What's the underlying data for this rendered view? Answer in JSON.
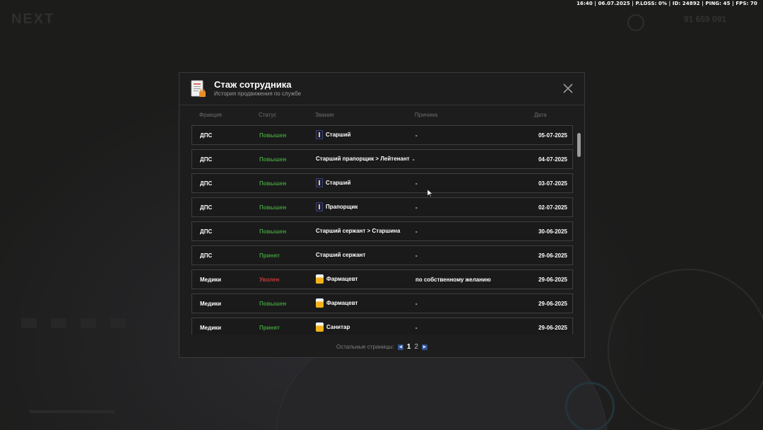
{
  "status_bar": {
    "text": "16:40 | 06.07.2025 | P.LOSS: 0% | ID: 24892 | PING: 45 | FPS: 70"
  },
  "background": {
    "brand": "NEXT",
    "money": "91 659 091"
  },
  "modal": {
    "title": "Стаж сотрудника",
    "subtitle": "История продвижения по службе",
    "icon": "document-icon",
    "close_icon": "close-icon"
  },
  "columns": {
    "faction": "Фракция",
    "status": "Статус",
    "rank": "Звание",
    "reason": "Причина",
    "date": "Дата"
  },
  "rows": [
    {
      "faction": "ДПС",
      "status": "Повышен",
      "status_type": "up",
      "rank": "Старший",
      "rank_icon": "shoulder-strap-icon",
      "reason": "-",
      "date": "05-07-2025"
    },
    {
      "faction": "ДПС",
      "status": "Повышен",
      "status_type": "up",
      "rank": "Старший прапорщик > Лейтенант",
      "rank_icon": "",
      "reason": "-",
      "date": "04-07-2025"
    },
    {
      "faction": "ДПС",
      "status": "Повышен",
      "status_type": "up",
      "rank": "Старший",
      "rank_icon": "shoulder-strap-icon",
      "reason": "-",
      "date": "03-07-2025"
    },
    {
      "faction": "ДПС",
      "status": "Повышен",
      "status_type": "up",
      "rank": "Прапорщик",
      "rank_icon": "shoulder-strap-icon",
      "reason": "-",
      "date": "02-07-2025"
    },
    {
      "faction": "ДПС",
      "status": "Повышен",
      "status_type": "up",
      "rank": "Старший сержант > Старшина",
      "rank_icon": "",
      "reason": "-",
      "date": "30-06-2025"
    },
    {
      "faction": "ДПС",
      "status": "Принят",
      "status_type": "up",
      "rank": "Старший сержант",
      "rank_icon": "",
      "reason": "-",
      "date": "29-06-2025"
    },
    {
      "faction": "Медики",
      "status": "Уволен",
      "status_type": "fired",
      "rank": "Фармацевт",
      "rank_icon": "medic-badge-icon",
      "reason": "по собственному желанию",
      "date": "29-06-2025"
    },
    {
      "faction": "Медики",
      "status": "Повышен",
      "status_type": "up",
      "rank": "Фармацевт",
      "rank_icon": "medic-badge-icon",
      "reason": "-",
      "date": "29-06-2025"
    },
    {
      "faction": "Медики",
      "status": "Принят",
      "status_type": "up",
      "rank": "Санитар",
      "rank_icon": "medic-badge-icon",
      "reason": "-",
      "date": "29-06-2025"
    }
  ],
  "pagination": {
    "label": "Остальные страницы:",
    "pages": [
      "1",
      "2"
    ],
    "current": "1"
  },
  "colors": {
    "status_up": "#3f9a3a",
    "status_fired": "#c23b35",
    "accent": "#2f4f8a"
  }
}
